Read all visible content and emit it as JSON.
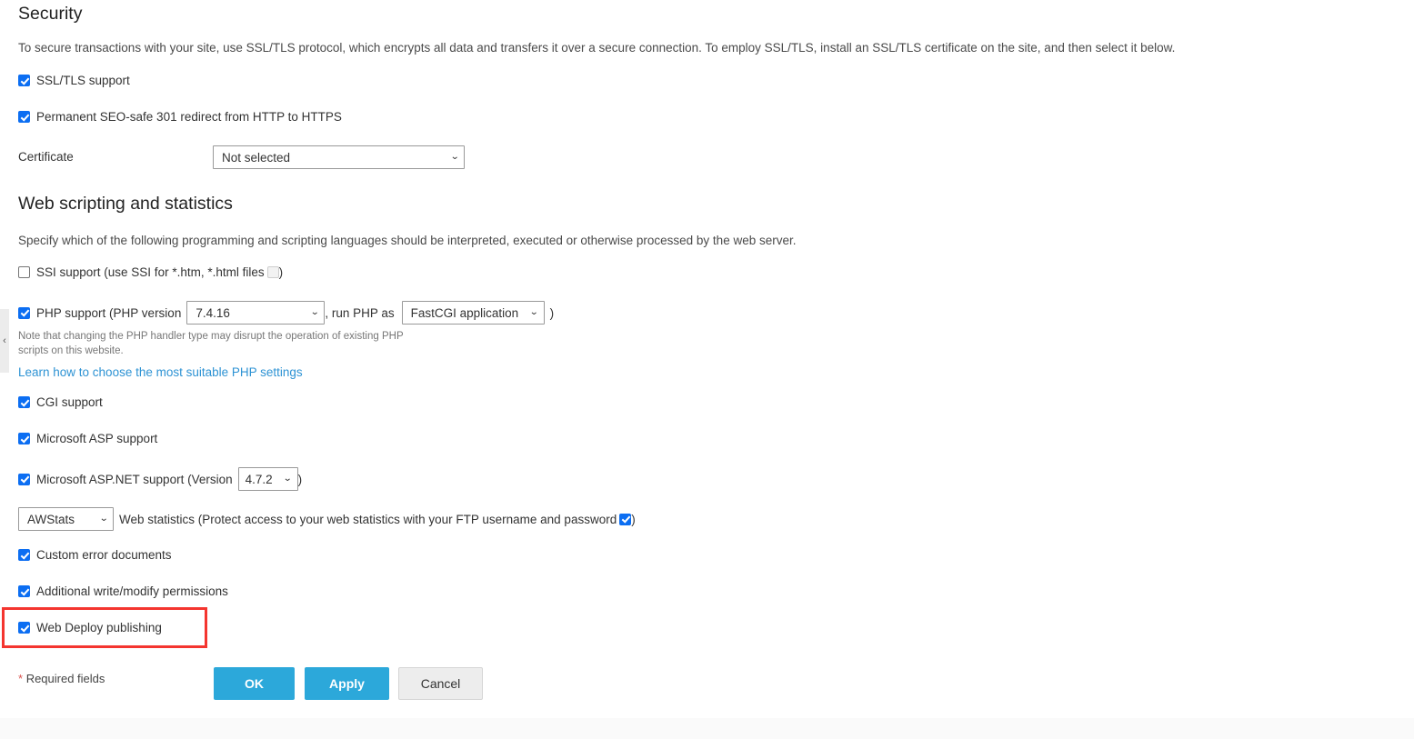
{
  "security": {
    "title": "Security",
    "description": "To secure transactions with your site, use SSL/TLS protocol, which encrypts all data and transfers it over a secure connection. To employ SSL/TLS, install an SSL/TLS certificate on the site, and then select it below.",
    "ssl_support_label": "SSL/TLS support",
    "ssl_support_checked": "checked",
    "redirect_label": "Permanent SEO-safe 301 redirect from HTTP to HTTPS",
    "redirect_checked": "checked",
    "certificate_label": "Certificate",
    "certificate_value": "Not selected"
  },
  "scripting": {
    "title": "Web scripting and statistics",
    "description": "Specify which of the following programming and scripting languages should be interpreted, executed or otherwise processed by the web server.",
    "ssi": {
      "label_before": "SSI support (use SSI for *.htm, *.html files",
      "label_after": ")"
    },
    "php": {
      "label_before": "PHP support (PHP version",
      "version_value": "7.4.16",
      "label_middle": ", run PHP as",
      "handler_value": "FastCGI application",
      "label_after": ")",
      "note_line1": "Note that changing the PHP handler type may disrupt the operation of existing PHP",
      "note_line2": "scripts on this website.",
      "link_text": "Learn how to choose the most suitable PHP settings"
    },
    "cgi_label": "CGI support",
    "asp_label": "Microsoft ASP support",
    "aspnet": {
      "label_before": "Microsoft ASP.NET support (Version",
      "version_value": "4.7.2",
      "label_after": ")"
    },
    "webstats": {
      "engine_value": "AWStats",
      "label_before": "Web statistics (Protect access to your web statistics with your FTP username and password",
      "label_after": ")"
    },
    "custom_error_label": "Custom error documents",
    "write_permissions_label": "Additional write/modify permissions",
    "web_deploy_label": "Web Deploy publishing"
  },
  "footer": {
    "required_star": "*",
    "required_text": "Required fields",
    "ok_label": "OK",
    "apply_label": "Apply",
    "cancel_label": "Cancel"
  },
  "icons": {
    "caret": "⌄",
    "collapse_chevron": "‹"
  },
  "colors": {
    "accent_blue": "#2ca8da",
    "checkbox_blue": "#0c6ef2",
    "link_blue": "#2e93d4",
    "highlight_red": "#f4352f",
    "required_red": "#d9534f"
  }
}
